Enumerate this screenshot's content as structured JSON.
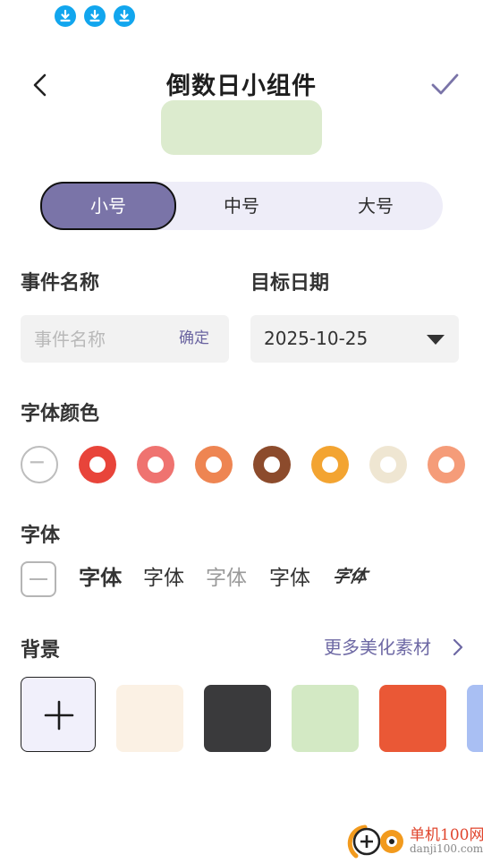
{
  "status_bar": {
    "icons": [
      "download-icon",
      "download-icon",
      "download-icon"
    ],
    "icon_color": "#12a6ee"
  },
  "header": {
    "title": "倒数日小组件",
    "back_icon": "chevron-left-icon",
    "confirm_icon": "checkmark-icon",
    "accent_color": "#7a74a8"
  },
  "preview": {
    "background": "#dcebce"
  },
  "size_selector": {
    "options": [
      "小号",
      "中号",
      "大号"
    ],
    "selected_index": 0
  },
  "event_name": {
    "label": "事件名称",
    "placeholder": "事件名称",
    "value": "",
    "confirm_label": "确定"
  },
  "target_date": {
    "label": "目标日期",
    "value": "2025-10-25"
  },
  "font_color": {
    "label": "字体颜色",
    "options": [
      "none",
      "#e8443a",
      "#ef7370",
      "#ee8552",
      "#8c4b2c",
      "#f3a431",
      "#efe6d2",
      "#f59c79"
    ]
  },
  "font": {
    "label": "字体",
    "options": [
      "字体",
      "字体",
      "字体",
      "字体",
      "字体"
    ]
  },
  "background": {
    "label": "背景",
    "more_label": "更多美化素材",
    "swatches": [
      "#fbf1e4",
      "#3a3a3c",
      "#d3e9c4",
      "#ea5836",
      "#a9bff3"
    ]
  },
  "watermark": {
    "brand": "单机100网",
    "url": "danji100.com"
  }
}
